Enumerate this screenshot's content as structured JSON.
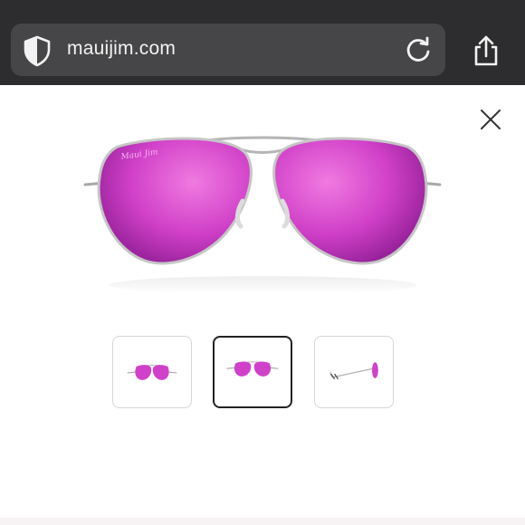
{
  "browser": {
    "url": "mauijim.com",
    "icons": {
      "security": "shield-icon",
      "reload": "reload-icon",
      "share": "share-icon"
    }
  },
  "viewer": {
    "close_icon": "close-icon",
    "brand_mark": "Maui Jim",
    "lens_color": "#d040c8",
    "thumbnails": [
      {
        "view": "front",
        "selected": false
      },
      {
        "view": "front",
        "selected": true
      },
      {
        "view": "side",
        "selected": false
      }
    ]
  },
  "colors": {
    "toolbar": "#2d2d2f",
    "urlbar": "#464648",
    "lens_dark": "#9b1c9e",
    "lens_light": "#f07ae0"
  }
}
